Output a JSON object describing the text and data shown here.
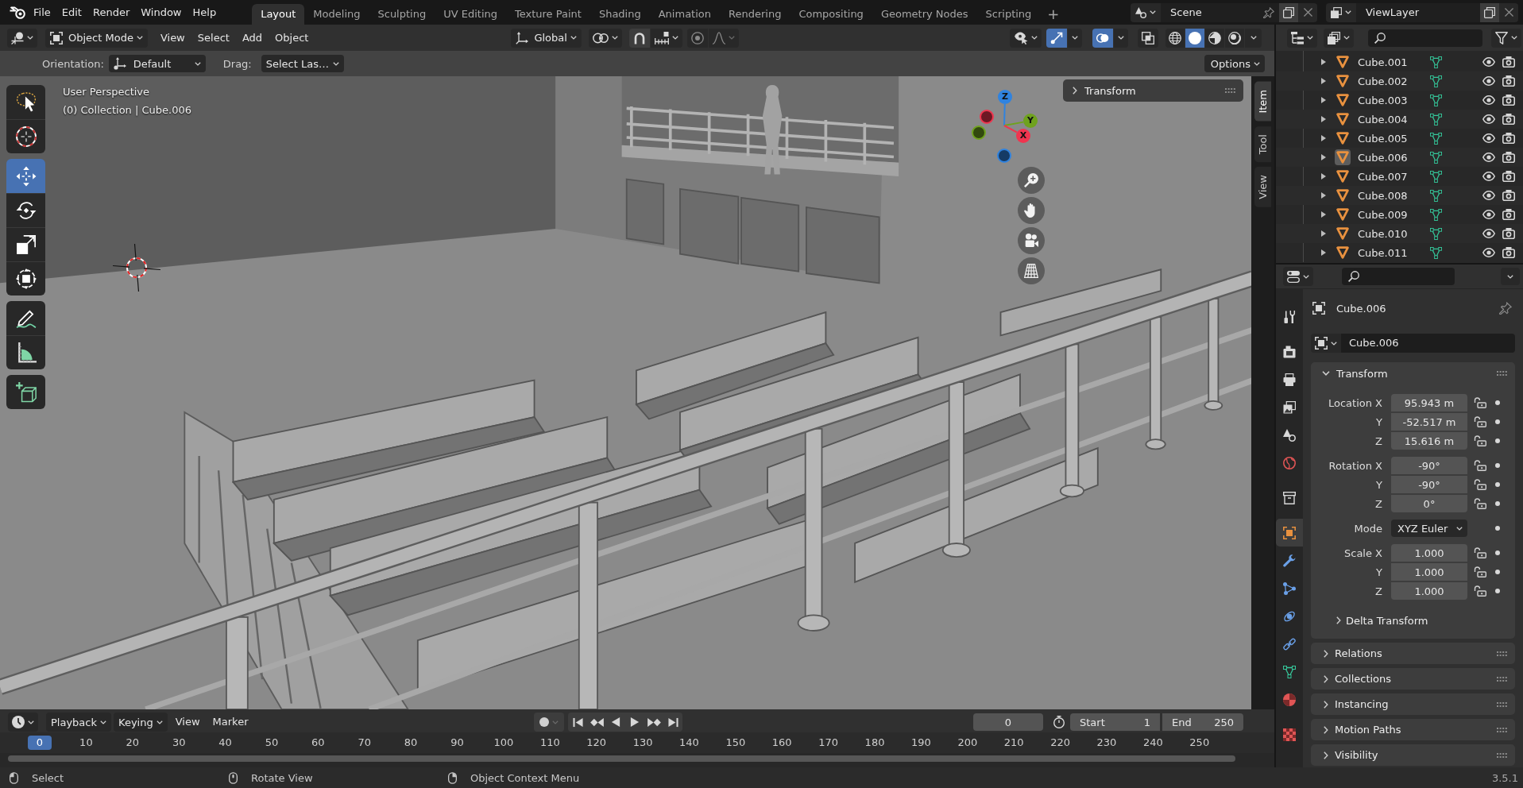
{
  "topbar": {
    "menus": [
      "File",
      "Edit",
      "Render",
      "Window",
      "Help"
    ],
    "workspaces": [
      {
        "label": "Layout",
        "selected": true
      },
      {
        "label": "Modeling",
        "selected": false
      },
      {
        "label": "Sculpting",
        "selected": false
      },
      {
        "label": "UV Editing",
        "selected": false
      },
      {
        "label": "Texture Paint",
        "selected": false
      },
      {
        "label": "Shading",
        "selected": false
      },
      {
        "label": "Animation",
        "selected": false
      },
      {
        "label": "Rendering",
        "selected": false
      },
      {
        "label": "Compositing",
        "selected": false
      },
      {
        "label": "Geometry Nodes",
        "selected": false
      },
      {
        "label": "Scripting",
        "selected": false
      }
    ],
    "add_workspace": "+",
    "scene": "Scene",
    "view_layer": "ViewLayer"
  },
  "viewport": {
    "header": {
      "mode": "Object Mode",
      "menus": [
        "View",
        "Select",
        "Add",
        "Object"
      ],
      "orientation": "Global",
      "gizmos_on": true,
      "overlays_on": true,
      "xray_on": false,
      "shading": [
        {
          "kind": "wireframe",
          "selected": false
        },
        {
          "kind": "solid",
          "selected": true
        },
        {
          "kind": "material",
          "selected": false
        },
        {
          "kind": "rendered",
          "selected": false
        }
      ]
    },
    "tool_settings": {
      "orientation_label": "Orientation:",
      "orientation": "Default",
      "drag_label": "Drag:",
      "drag": "Select Las…",
      "options": "Options"
    },
    "info": [
      "User Perspective",
      "(0) Collection | Cube.006"
    ],
    "toolbar": {
      "groups": [
        {
          "tools": [
            {
              "kind": "select_lasso",
              "selected": false
            },
            {
              "kind": "cursor",
              "selected": false
            }
          ]
        },
        {
          "tools": [
            {
              "kind": "move",
              "selected": true
            },
            {
              "kind": "rotate",
              "selected": false
            },
            {
              "kind": "scale",
              "selected": false
            },
            {
              "kind": "transform",
              "selected": false
            }
          ]
        },
        {
          "tools": [
            {
              "kind": "annotate",
              "selected": false
            },
            {
              "kind": "measure",
              "selected": false
            }
          ]
        },
        {
          "tools": [
            {
              "kind": "add_cube",
              "selected": false
            }
          ]
        }
      ]
    },
    "gizmo": {
      "axes": [
        {
          "label": "Z",
          "color": "#2f83e0"
        },
        {
          "label": "Y",
          "color": "#6fa21e"
        },
        {
          "label": "X",
          "color": "#f0354f"
        }
      ]
    },
    "sidebar": {
      "tabs": [
        {
          "label": "Item",
          "selected": true
        },
        {
          "label": "Tool",
          "selected": false
        },
        {
          "label": "View",
          "selected": false
        }
      ],
      "panel": {
        "title": "Transform",
        "expanded": false
      }
    }
  },
  "outliner": {
    "rows": [
      {
        "name": "Cube.001",
        "active": false,
        "visible": true,
        "renderable": true
      },
      {
        "name": "Cube.002",
        "active": false,
        "visible": true,
        "renderable": true
      },
      {
        "name": "Cube.003",
        "active": false,
        "visible": true,
        "renderable": true
      },
      {
        "name": "Cube.004",
        "active": false,
        "visible": true,
        "renderable": true
      },
      {
        "name": "Cube.005",
        "active": false,
        "visible": true,
        "renderable": true
      },
      {
        "name": "Cube.006",
        "active": true,
        "visible": true,
        "renderable": true
      },
      {
        "name": "Cube.007",
        "active": false,
        "visible": true,
        "renderable": true
      },
      {
        "name": "Cube.008",
        "active": false,
        "visible": true,
        "renderable": true
      },
      {
        "name": "Cube.009",
        "active": false,
        "visible": true,
        "renderable": true
      },
      {
        "name": "Cube.010",
        "active": false,
        "visible": true,
        "renderable": true
      },
      {
        "name": "Cube.011",
        "active": false,
        "visible": true,
        "renderable": true
      }
    ]
  },
  "properties": {
    "tab_groups": [
      {
        "tabs": [
          {
            "kind": "tool",
            "selected": false
          }
        ]
      },
      {
        "tabs": [
          {
            "kind": "render",
            "selected": false
          },
          {
            "kind": "output",
            "selected": false
          },
          {
            "kind": "view_layer",
            "selected": false
          },
          {
            "kind": "scene",
            "selected": false
          },
          {
            "kind": "world",
            "selected": false
          }
        ]
      },
      {
        "tabs": [
          {
            "kind": "collection",
            "selected": false
          }
        ]
      },
      {
        "tabs": [
          {
            "kind": "object",
            "selected": true
          },
          {
            "kind": "modifiers",
            "selected": false
          },
          {
            "kind": "particles",
            "selected": false
          },
          {
            "kind": "physics",
            "selected": false
          },
          {
            "kind": "constraints",
            "selected": false
          },
          {
            "kind": "data",
            "selected": false
          },
          {
            "kind": "material",
            "selected": false
          }
        ]
      },
      {
        "tabs": [
          {
            "kind": "texture",
            "selected": false
          }
        ]
      }
    ],
    "object_name": "Cube.006",
    "data_name": "Cube.006",
    "panels": [
      {
        "title": "Transform",
        "expanded": true,
        "groups": [
          {
            "rows": [
              {
                "kind": "number",
                "label": "Location X",
                "value": "95.943 m"
              },
              {
                "kind": "number",
                "label": "Y",
                "value": "-52.517 m"
              },
              {
                "kind": "number",
                "label": "Z",
                "value": "15.616 m"
              }
            ]
          },
          {
            "rows": [
              {
                "kind": "number",
                "label": "Rotation X",
                "value": "-90°"
              },
              {
                "kind": "number",
                "label": "Y",
                "value": "-90°"
              },
              {
                "kind": "number",
                "label": "Z",
                "value": "0°"
              }
            ]
          },
          {
            "rows": [
              {
                "kind": "dropdown",
                "label": "Mode",
                "value": "XYZ Euler"
              }
            ]
          },
          {
            "rows": [
              {
                "kind": "number",
                "label": "Scale X",
                "value": "1.000"
              },
              {
                "kind": "number",
                "label": "Y",
                "value": "1.000"
              },
              {
                "kind": "number",
                "label": "Z",
                "value": "1.000"
              }
            ]
          }
        ],
        "subpanels": [
          {
            "title": "Delta Transform",
            "expanded": false
          }
        ]
      },
      {
        "title": "Relations",
        "expanded": false
      },
      {
        "title": "Collections",
        "expanded": false
      },
      {
        "title": "Instancing",
        "expanded": false
      },
      {
        "title": "Motion Paths",
        "expanded": false
      },
      {
        "title": "Visibility",
        "expanded": false
      }
    ]
  },
  "timeline": {
    "menus": [
      {
        "kind": "dropdown",
        "label": "Playback"
      },
      {
        "kind": "dropdown",
        "label": "Keying"
      },
      {
        "kind": "menu",
        "label": "View"
      },
      {
        "kind": "menu",
        "label": "Marker"
      }
    ],
    "auto_keying": false,
    "current_frame": "0",
    "start_label": "Start",
    "start": "1",
    "end_label": "End",
    "end": "250",
    "frames": [
      {
        "label": "0",
        "selected": true
      },
      {
        "label": "10",
        "selected": false
      },
      {
        "label": "20",
        "selected": false
      },
      {
        "label": "30",
        "selected": false
      },
      {
        "label": "40",
        "selected": false
      },
      {
        "label": "50",
        "selected": false
      },
      {
        "label": "60",
        "selected": false
      },
      {
        "label": "70",
        "selected": false
      },
      {
        "label": "80",
        "selected": false
      },
      {
        "label": "90",
        "selected": false
      },
      {
        "label": "100",
        "selected": false
      },
      {
        "label": "110",
        "selected": false
      },
      {
        "label": "120",
        "selected": false
      },
      {
        "label": "130",
        "selected": false
      },
      {
        "label": "140",
        "selected": false
      },
      {
        "label": "150",
        "selected": false
      },
      {
        "label": "160",
        "selected": false
      },
      {
        "label": "170",
        "selected": false
      },
      {
        "label": "180",
        "selected": false
      },
      {
        "label": "190",
        "selected": false
      },
      {
        "label": "200",
        "selected": false
      },
      {
        "label": "210",
        "selected": false
      },
      {
        "label": "220",
        "selected": false
      },
      {
        "label": "230",
        "selected": false
      },
      {
        "label": "240",
        "selected": false
      },
      {
        "label": "250",
        "selected": false
      }
    ]
  },
  "status_bar": {
    "hints": [
      {
        "kind": "left",
        "label": "Select"
      },
      {
        "kind": "middle",
        "label": "Rotate View"
      },
      {
        "kind": "right",
        "label": "Object Context Menu"
      }
    ],
    "version": "3.5.1"
  }
}
